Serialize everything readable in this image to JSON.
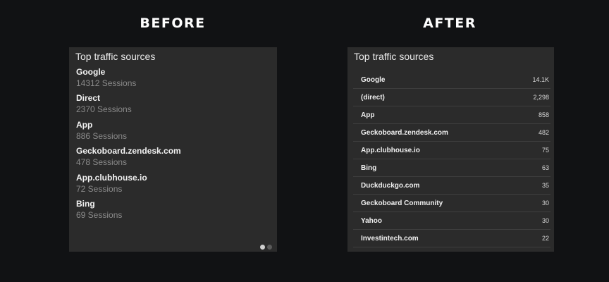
{
  "headings": {
    "before": "BEFORE",
    "after": "AFTER"
  },
  "before_panel": {
    "title": "Top traffic sources",
    "items": [
      {
        "name": "Google",
        "sessions": "14312 Sessions"
      },
      {
        "name": "Direct",
        "sessions": "2370 Sessions"
      },
      {
        "name": "App",
        "sessions": "886 Sessions"
      },
      {
        "name": "Geckoboard.zendesk.com",
        "sessions": "478 Sessions"
      },
      {
        "name": "App.clubhouse.io",
        "sessions": "72 Sessions"
      },
      {
        "name": "Bing",
        "sessions": "69 Sessions"
      }
    ],
    "pager": {
      "pages": 2,
      "current": 1
    }
  },
  "after_panel": {
    "title": "Top traffic sources",
    "rows": [
      {
        "name": "Google",
        "value": "14.1K"
      },
      {
        "name": "(direct)",
        "value": "2,298"
      },
      {
        "name": "App",
        "value": "858"
      },
      {
        "name": "Geckoboard.zendesk.com",
        "value": "482"
      },
      {
        "name": "App.clubhouse.io",
        "value": "75"
      },
      {
        "name": "Bing",
        "value": "63"
      },
      {
        "name": "Duckduckgo.com",
        "value": "35"
      },
      {
        "name": "Geckoboard Community",
        "value": "30"
      },
      {
        "name": "Yahoo",
        "value": "30"
      },
      {
        "name": "Investintech.com",
        "value": "22"
      }
    ]
  }
}
